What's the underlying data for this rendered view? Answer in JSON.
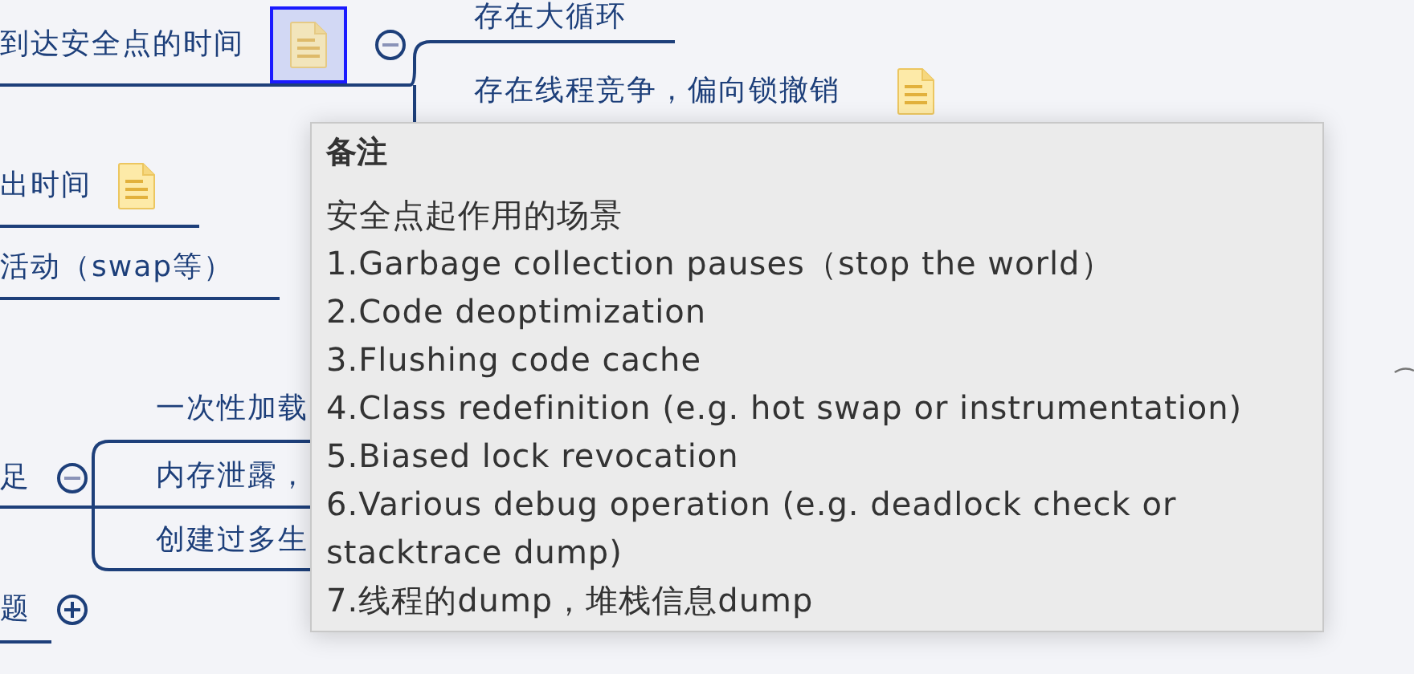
{
  "mind_map": {
    "nodes": [
      {
        "text": "到达安全点的时间",
        "note": {
          "selected": true
        },
        "toggle": {
          "expanded": true
        }
      },
      {
        "text": "存在大循环"
      },
      {
        "text": "存在线程竞争，偏向锁撤销",
        "note": {
          "selected": false
        }
      },
      {
        "text": "出时间",
        "note": {
          "selected": false
        }
      },
      {
        "text": "活动（swap等）"
      },
      {
        "text": "一次性加载"
      },
      {
        "text": "足",
        "toggle": {
          "expanded": true
        }
      },
      {
        "text": "内存泄露，"
      },
      {
        "text": "创建过多生"
      },
      {
        "text": "题",
        "toggle": {
          "expanded": false
        }
      }
    ]
  },
  "note_popup": {
    "title": "备注",
    "lines": [
      "安全点起作用的场景",
      "1.Garbage collection pauses（stop the world）",
      "2.Code deoptimization",
      "3.Flushing code cache",
      "4.Class redefinition (e.g. hot swap or instrumentation)",
      "5.Biased lock revocation",
      "6.Various debug operation (e.g. deadlock check or stacktrace dump)",
      "7.线程的dump，堆栈信息dump"
    ]
  }
}
